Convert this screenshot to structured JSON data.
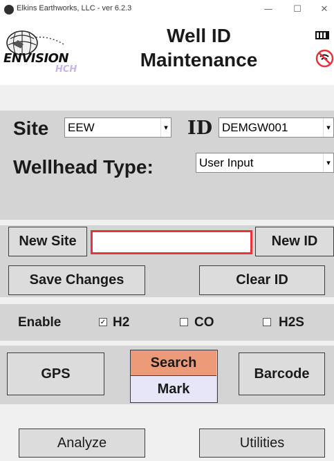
{
  "window": {
    "title": "Elkins Earthworks, LLC - ver 6.2.3",
    "min_glyph": "—",
    "max_glyph": "☐",
    "close_glyph": "✕"
  },
  "header": {
    "title_line1": "Well ID",
    "title_line2": "Maintenance",
    "logo_text": "ENVISION",
    "logo_sub": "HCH"
  },
  "site": {
    "label": "Site",
    "value": "EEW"
  },
  "id": {
    "label": "ID",
    "value": "DEMGW001"
  },
  "wellhead": {
    "label": "Wellhead Type:",
    "value": "User Input"
  },
  "new_site": {
    "label": "New Site",
    "input_value": ""
  },
  "new_id": {
    "label": "New ID"
  },
  "actions": {
    "save": "Save Changes",
    "clear": "Clear ID"
  },
  "enable": {
    "label": "Enable",
    "options": [
      {
        "label": "H2",
        "checked": true
      },
      {
        "label": "CO",
        "checked": false
      },
      {
        "label": "H2S",
        "checked": false
      }
    ]
  },
  "tools": {
    "gps": "GPS",
    "search": "Search",
    "mark": "Mark",
    "barcode": "Barcode"
  },
  "footer": {
    "analyze": "Analyze",
    "utilities": "Utilities"
  },
  "colors": {
    "search_bg": "#ec9a77",
    "mark_bg": "#e6e6f8",
    "input_border": "#e8313a",
    "panel_bg": "#d4d4d4"
  }
}
